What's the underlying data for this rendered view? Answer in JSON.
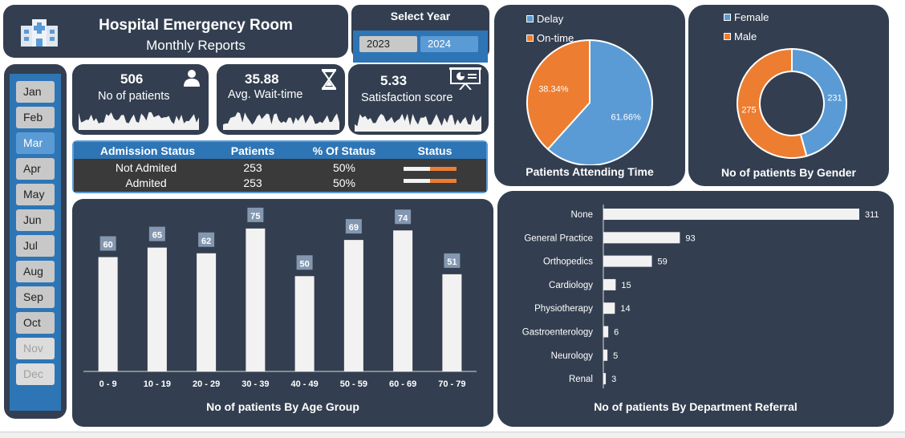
{
  "header": {
    "title": "Hospital Emergency Room",
    "subtitle": "Monthly Reports"
  },
  "year_selector": {
    "label": "Select Year",
    "years": [
      "2023",
      "2024"
    ],
    "selected": "2024"
  },
  "months": {
    "items": [
      "Jan",
      "Feb",
      "Mar",
      "Apr",
      "May",
      "Jun",
      "Jul",
      "Aug",
      "Sep",
      "Oct",
      "Nov",
      "Dec"
    ],
    "selected": "Mar",
    "disabled": [
      "Nov",
      "Dec"
    ]
  },
  "kpis": [
    {
      "value": "506",
      "label": "No of patients",
      "icon": "person-icon"
    },
    {
      "value": "35.88",
      "label": "Avg. Wait-time",
      "icon": "hourglass-icon"
    },
    {
      "value": "5.33",
      "label": "Satisfaction score",
      "icon": "presentation-board-icon"
    }
  ],
  "status_table": {
    "headers": [
      "Admission Status",
      "Patients",
      "% Of Status",
      "Status"
    ],
    "rows": [
      {
        "status": "Not Admited",
        "patients": "253",
        "percent": "50%",
        "fraction": 0.5
      },
      {
        "status": "Admited",
        "patients": "253",
        "percent": "50%",
        "fraction": 0.5
      }
    ]
  },
  "colors": {
    "panel": "#333f50",
    "accent_blue": "#5b9bd5",
    "accent_orange": "#ed7d31",
    "deep_blue": "#2e75b6",
    "bar_white": "#f2f2f2"
  },
  "chart_data": [
    {
      "type": "bar",
      "title": "No of patients By Age Group",
      "categories": [
        "0 - 9",
        "10 - 19",
        "20 - 29",
        "30 - 39",
        "40 - 49",
        "50 - 59",
        "60 - 69",
        "70 - 79"
      ],
      "values": [
        60,
        65,
        62,
        75,
        50,
        69,
        74,
        51
      ],
      "ylim": [
        0,
        80
      ],
      "grid": false
    },
    {
      "type": "pie",
      "title": "Patients Attending Time",
      "series": [
        {
          "name": "Delay",
          "value": 61.66,
          "label": "61.66%",
          "color": "#5b9bd5"
        },
        {
          "name": "On-time",
          "value": 38.34,
          "label": "38.34%",
          "color": "#ed7d31"
        }
      ],
      "legend": "top-left"
    },
    {
      "type": "pie",
      "title": "No of patients By Gender",
      "donut": true,
      "series": [
        {
          "name": "Female",
          "value": 231,
          "label": "231",
          "color": "#5b9bd5"
        },
        {
          "name": "Male",
          "value": 275,
          "label": "275",
          "color": "#ed7d31"
        }
      ],
      "legend": "top-left"
    },
    {
      "type": "bar",
      "orientation": "horizontal",
      "title": "No of patients By Department Referral",
      "categories": [
        "None",
        "General Practice",
        "Orthopedics",
        "Cardiology",
        "Physiotherapy",
        "Gastroenterology",
        "Neurology",
        "Renal"
      ],
      "values": [
        311,
        93,
        59,
        15,
        14,
        6,
        5,
        3
      ],
      "grid": false
    }
  ]
}
